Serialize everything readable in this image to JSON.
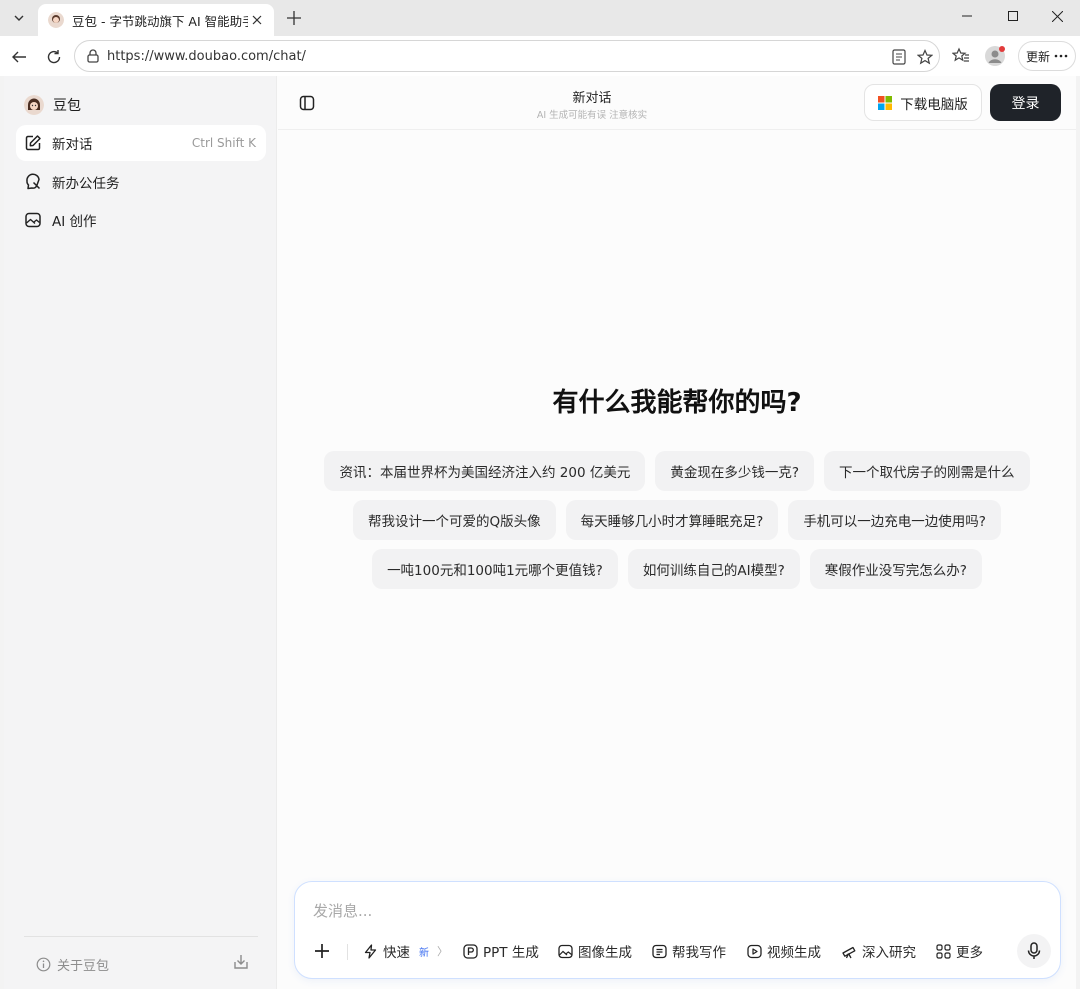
{
  "browser": {
    "tab_title": "豆包 - 字节跳动旗下 AI 智能助手",
    "url": "https://www.doubao.com/chat/",
    "update_label": "更新"
  },
  "sidebar": {
    "brand": "豆包",
    "items": [
      {
        "label": "新对话",
        "shortcut": "Ctrl Shift K",
        "icon": "edit-icon"
      },
      {
        "label": "新办公任务",
        "icon": "office-task-icon"
      },
      {
        "label": "AI 创作",
        "icon": "image-create-icon"
      }
    ],
    "about": "关于豆包"
  },
  "header": {
    "title": "新对话",
    "subtitle": "AI 生成可能有误 注意核实",
    "download_label": "下载电脑版",
    "login_label": "登录"
  },
  "main": {
    "heading": "有什么我能帮你的吗?",
    "suggestions": [
      [
        "资讯：本届世界杯为美国经济注入约 200 亿美元",
        "黄金现在多少钱一克?",
        "下一个取代房子的刚需是什么"
      ],
      [
        "帮我设计一个可爱的Q版头像",
        "每天睡够几小时才算睡眠充足?",
        "手机可以一边充电一边使用吗?"
      ],
      [
        "一吨100元和100吨1元哪个更值钱?",
        "如何训练自己的AI模型?",
        "寒假作业没写完怎么办?"
      ]
    ]
  },
  "composer": {
    "placeholder": "发消息...",
    "tools": {
      "fast": "快速",
      "fast_badge": "新",
      "ppt": "PPT 生成",
      "image": "图像生成",
      "write": "帮我写作",
      "video": "视频生成",
      "research": "深入研究",
      "more": "更多"
    }
  },
  "colors": {
    "accent": "#3b6df0",
    "login_bg": "#1f2329"
  }
}
